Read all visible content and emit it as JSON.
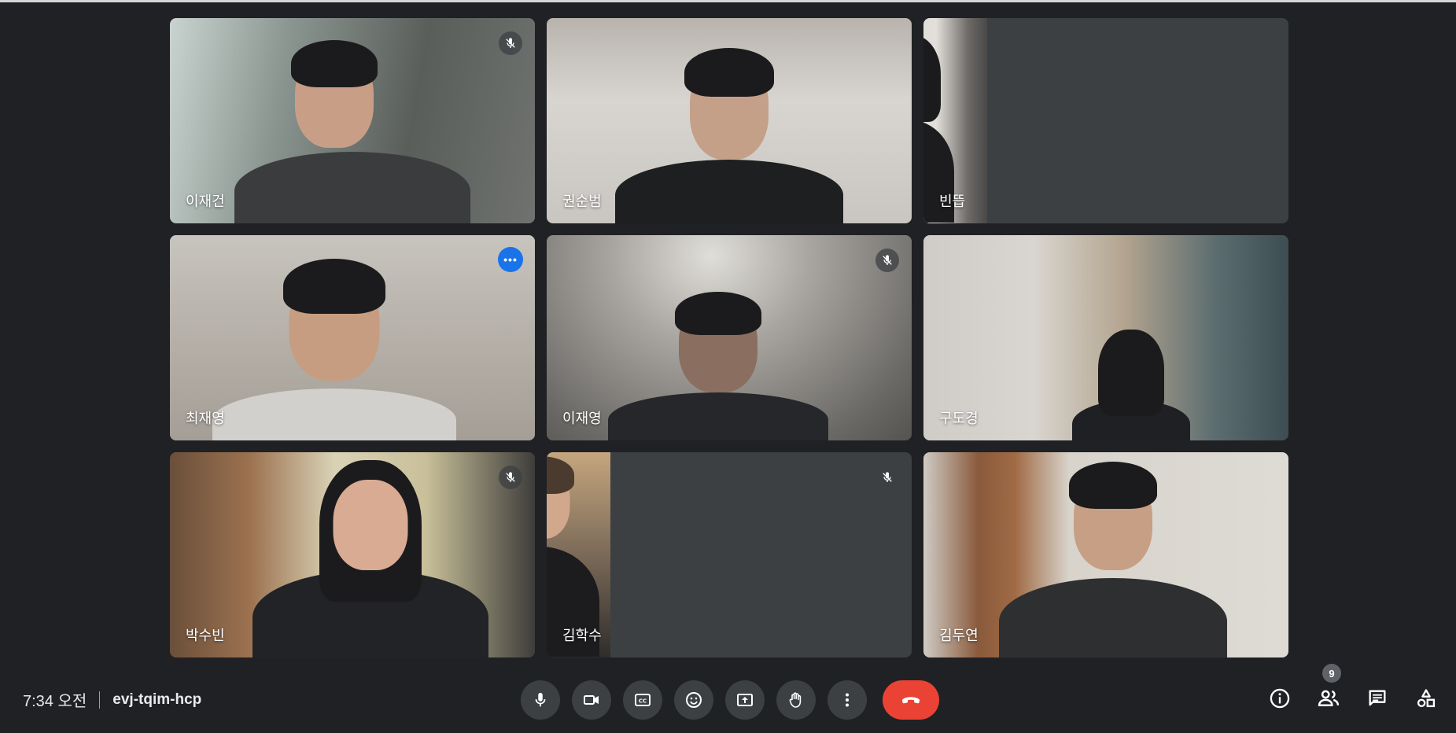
{
  "participants": [
    {
      "name": "이재건",
      "muted": true
    },
    {
      "name": "권순범",
      "muted": false
    },
    {
      "name": "빈뜹",
      "muted": false
    },
    {
      "name": "최재영",
      "muted": false,
      "active": true
    },
    {
      "name": "이재영",
      "muted": true
    },
    {
      "name": "구도경",
      "muted": false
    },
    {
      "name": "박수빈",
      "muted": true
    },
    {
      "name": "김학수",
      "muted": true
    },
    {
      "name": "김두연",
      "muted": false
    }
  ],
  "footer": {
    "time": "7:34 오전",
    "meeting_code": "evj-tqim-hcp"
  },
  "controls": {
    "icons": [
      "microphone-icon",
      "camera-icon",
      "captions-icon",
      "emoji-icon",
      "present-screen-icon",
      "raise-hand-icon",
      "more-options-icon",
      "end-call-icon"
    ]
  },
  "right_controls": {
    "people_count": "9",
    "icons": [
      "info-icon",
      "people-icon",
      "chat-icon",
      "activities-icon"
    ]
  },
  "colors": {
    "background": "#202124",
    "tile": "#3c4043",
    "end_call": "#ea4335",
    "active_border": "#8ab4f8",
    "accent": "#1a73e8"
  }
}
